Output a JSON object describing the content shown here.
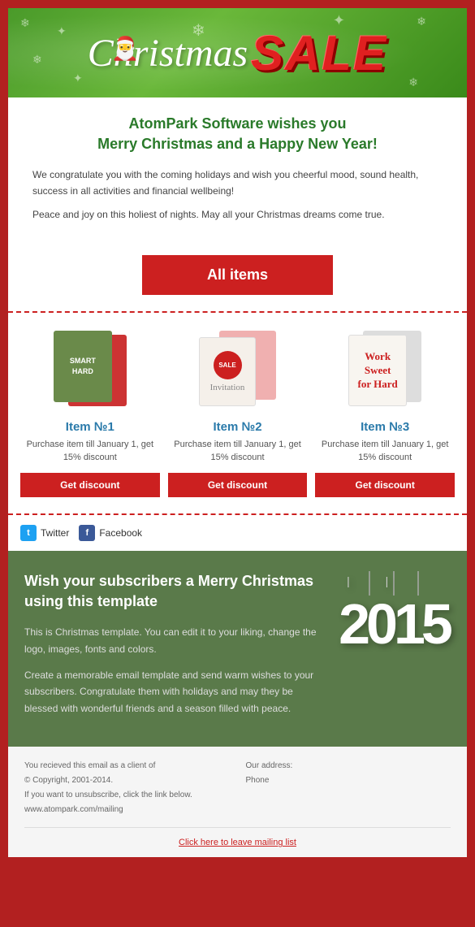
{
  "header": {
    "christmas_text": "Christmas",
    "sale_text": "SALE",
    "hat_emoji": "🎅"
  },
  "greeting": {
    "title_line1": "AtomPark Software wishes you",
    "title_line2": "Merry Christmas and a Happy New Year!",
    "body1": "We congratulate you with the coming holidays and wish you cheerful mood, sound health, success in all activities and financial wellbeing!",
    "body2": "Peace and joy on this holiest of nights. May all your Christmas dreams come true."
  },
  "all_items_button": {
    "label": "All items"
  },
  "items": [
    {
      "name": "Item №1",
      "description": "Purchase item till January 1, get 15% discount",
      "button_label": "Get discount",
      "card_text": "SMART\nHARD"
    },
    {
      "name": "Item №2",
      "description": "Purchase item till January 1, get 15% discount",
      "button_label": "Get discount",
      "card_text": "SALE"
    },
    {
      "name": "Item №3",
      "description": "Purchase item till January 1, get 15% discount",
      "button_label": "Get discount",
      "card_text": "Work Sweet for Hard"
    }
  ],
  "social": {
    "twitter_label": "Twitter",
    "facebook_label": "Facebook",
    "twitter_icon": "t",
    "facebook_icon": "f"
  },
  "promo": {
    "title": "Wish your subscribers a Merry Christmas using this template",
    "body1": "This is Christmas template. You can edit it to your liking, change the logo, images, fonts and colors.",
    "body2": "Create a memorable email template and send warm wishes to your subscribers. Congratulate them with holidays and may they be blessed with wonderful friends and a season filled with peace.",
    "year": "2015"
  },
  "footer": {
    "left_line1": "You recieved this email as a client of",
    "left_line2": "© Copyright, 2001-2014.",
    "left_line3": "If you want to unsubscribe, click the link below.",
    "left_line4": "www.atompark.com/mailing",
    "right_line1": "Our address:",
    "right_line2": "",
    "right_line3": "Phone",
    "unsubscribe_link": "Click here to leave mailing list"
  }
}
